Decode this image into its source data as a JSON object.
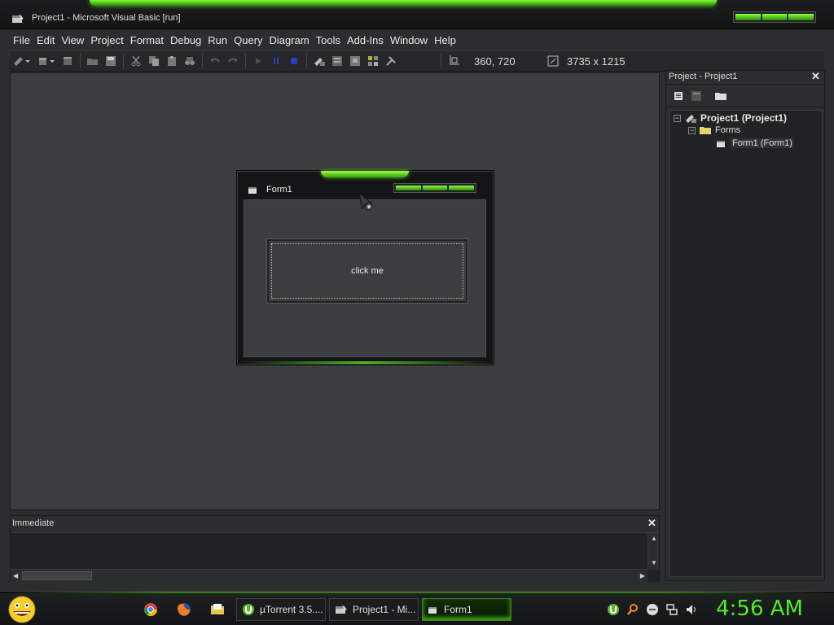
{
  "window": {
    "title": "Project1 - Microsoft Visual Basic [run]"
  },
  "menu": {
    "items": [
      "File",
      "Edit",
      "View",
      "Project",
      "Format",
      "Debug",
      "Run",
      "Query",
      "Diagram",
      "Tools",
      "Add-Ins",
      "Window",
      "Help"
    ]
  },
  "toolbar": {
    "position_readout": "360, 720",
    "size_readout": "3735 x 1215"
  },
  "form": {
    "title": "Form1",
    "button_label": "click me"
  },
  "project_panel": {
    "title": "Project - Project1",
    "tree": {
      "root": "Project1 (Project1)",
      "folder": "Forms",
      "item": "Form1 (Form1)"
    }
  },
  "immediate": {
    "title": "Immediate"
  },
  "taskbar": {
    "buttons": [
      {
        "label": "µTorrent 3.5...."
      },
      {
        "label": "Project1 - Mi..."
      },
      {
        "label": "Form1"
      }
    ],
    "clock": "4:56 AM"
  },
  "colors": {
    "accent_green": "#4af022",
    "background": "#2b2d2e"
  }
}
